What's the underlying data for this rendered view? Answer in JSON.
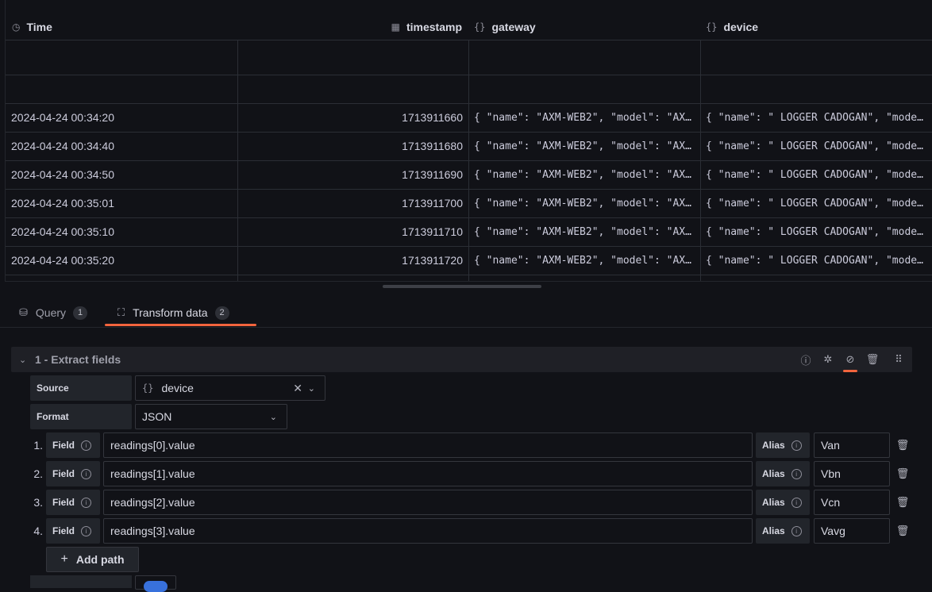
{
  "table": {
    "headers": [
      {
        "icon": "clock-icon",
        "glyph": "◷",
        "label": "Time"
      },
      {
        "icon": "calculator-icon",
        "glyph": "▦",
        "label": "timestamp"
      },
      {
        "icon": "braces-icon",
        "glyph": "{}",
        "label": "gateway"
      },
      {
        "icon": "braces-icon",
        "glyph": "{}",
        "label": "device"
      }
    ],
    "rows": [
      {
        "time": "",
        "timestamp": "",
        "gateway": "",
        "device": ""
      },
      {
        "time": "",
        "timestamp": "",
        "gateway": "",
        "device": ""
      },
      {
        "time": "2024-04-24 00:34:20",
        "timestamp": "1713911660",
        "gateway": "{ \"name\": \"AXM-WEB2\", \"model\": \"AX…",
        "device": "{ \"name\": \" LOGGER CADOGAN\", \"mode…"
      },
      {
        "time": "2024-04-24 00:34:40",
        "timestamp": "1713911680",
        "gateway": "{ \"name\": \"AXM-WEB2\", \"model\": \"AX…",
        "device": "{ \"name\": \" LOGGER CADOGAN\", \"mode…"
      },
      {
        "time": "2024-04-24 00:34:50",
        "timestamp": "1713911690",
        "gateway": "{ \"name\": \"AXM-WEB2\", \"model\": \"AX…",
        "device": "{ \"name\": \" LOGGER CADOGAN\", \"mode…"
      },
      {
        "time": "2024-04-24 00:35:01",
        "timestamp": "1713911700",
        "gateway": "{ \"name\": \"AXM-WEB2\", \"model\": \"AX…",
        "device": "{ \"name\": \" LOGGER CADOGAN\", \"mode…"
      },
      {
        "time": "2024-04-24 00:35:10",
        "timestamp": "1713911710",
        "gateway": "{ \"name\": \"AXM-WEB2\", \"model\": \"AX…",
        "device": "{ \"name\": \" LOGGER CADOGAN\", \"mode…"
      },
      {
        "time": "2024-04-24 00:35:20",
        "timestamp": "1713911720",
        "gateway": "{ \"name\": \"AXM-WEB2\", \"model\": \"AX…",
        "device": "{ \"name\": \" LOGGER CADOGAN\", \"mode…"
      }
    ]
  },
  "tabs": [
    {
      "icon": "database-icon",
      "glyph": "⛁",
      "label": "Query",
      "count": "1",
      "active": false
    },
    {
      "icon": "transform-icon",
      "glyph": "⛶",
      "label": "Transform data",
      "count": "2",
      "active": true
    }
  ],
  "transformation": {
    "title": "1 - Extract fields",
    "header_icons": [
      "info-icon",
      "debug-icon",
      "disable-icon",
      "delete-icon",
      "drag-handle-icon"
    ],
    "source_label": "Source",
    "source_value": "device",
    "source_icon_glyph": "{}",
    "format_label": "Format",
    "format_value": "JSON",
    "field_label": "Field",
    "alias_label": "Alias",
    "paths": [
      {
        "index": "1.",
        "path": "readings[0].value",
        "alias": "Van"
      },
      {
        "index": "2.",
        "path": "readings[1].value",
        "alias": "Vbn"
      },
      {
        "index": "3.",
        "path": "readings[2].value",
        "alias": "Vcn"
      },
      {
        "index": "4.",
        "path": "readings[3].value",
        "alias": "Vavg"
      }
    ],
    "add_path_label": "Add path"
  },
  "colors": {
    "background": "#111217",
    "accent": "#f2643d",
    "toggle_on": "#3871dc"
  }
}
